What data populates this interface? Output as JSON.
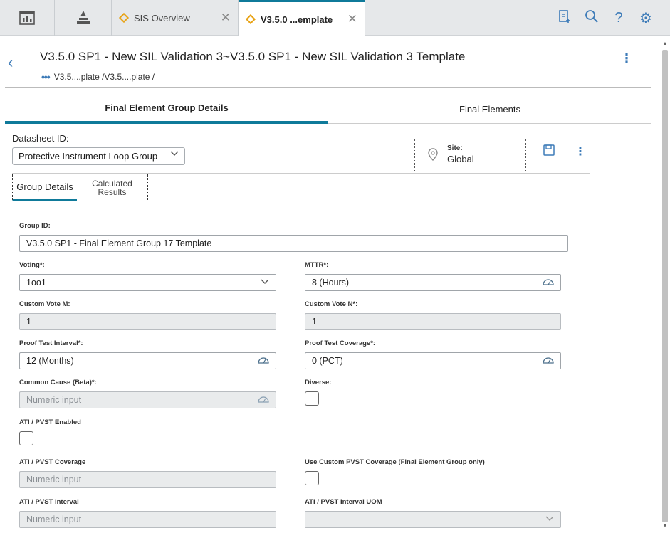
{
  "topbar": {
    "tabs": [
      {
        "label": "SIS Overview",
        "close": "✕"
      },
      {
        "label": "V3.5.0 ...emplate",
        "close": "✕"
      }
    ],
    "icons": [
      "dashboard-icon",
      "hierarchy-icon",
      "queue-icon",
      "search-icon",
      "help-icon",
      "settings-icon"
    ]
  },
  "header": {
    "title": "V3.5.0 SP1 - New SIL Validation 3~V3.5.0 SP1 - New SIL Validation 3 Template",
    "breadcrumb": "V3.5....plate /V3.5....plate /"
  },
  "main_tabs": [
    "Final Element Group Details",
    "Final Elements"
  ],
  "datasheet": {
    "label": "Datasheet ID:",
    "value": "Protective Instrument Loop Group"
  },
  "site": {
    "label": "Site:",
    "value": "Global"
  },
  "sub_tabs": [
    "Group Details",
    "Calculated Results"
  ],
  "fields": {
    "group_id": {
      "label": "Group ID:",
      "value": "V3.5.0 SP1 - Final Element Group 17 Template"
    },
    "voting": {
      "label": "Voting*:",
      "value": "1oo1"
    },
    "mttr": {
      "label": "MTTR*:",
      "value": "8 (Hours)"
    },
    "custom_vote_m": {
      "label": "Custom Vote M:",
      "value": "1"
    },
    "custom_vote_n": {
      "label": "Custom Vote N*:",
      "value": "1"
    },
    "proof_test_interval": {
      "label": "Proof Test Interval*:",
      "value": "12 (Months)"
    },
    "proof_test_coverage": {
      "label": "Proof Test Coverage*:",
      "value": "0 (PCT)"
    },
    "common_cause": {
      "label": "Common Cause (Beta)*:",
      "placeholder": "Numeric input"
    },
    "diverse": {
      "label": "Diverse:"
    },
    "ati_pvst_enabled": {
      "label": "ATI / PVST Enabled"
    },
    "ati_pvst_coverage": {
      "label": "ATI / PVST Coverage",
      "placeholder": "Numeric input"
    },
    "use_custom_pvst": {
      "label": "Use Custom PVST Coverage (Final Element Group only)"
    },
    "ati_pvst_interval": {
      "label": "ATI / PVST Interval",
      "placeholder": "Numeric input"
    },
    "ati_pvst_interval_uom": {
      "label": "ATI / PVST Interval UOM",
      "value": ""
    }
  },
  "colors": {
    "accent": "#0f7a9a",
    "icon_blue": "#3d7bb8",
    "tab_diamond": "#e8a317"
  }
}
